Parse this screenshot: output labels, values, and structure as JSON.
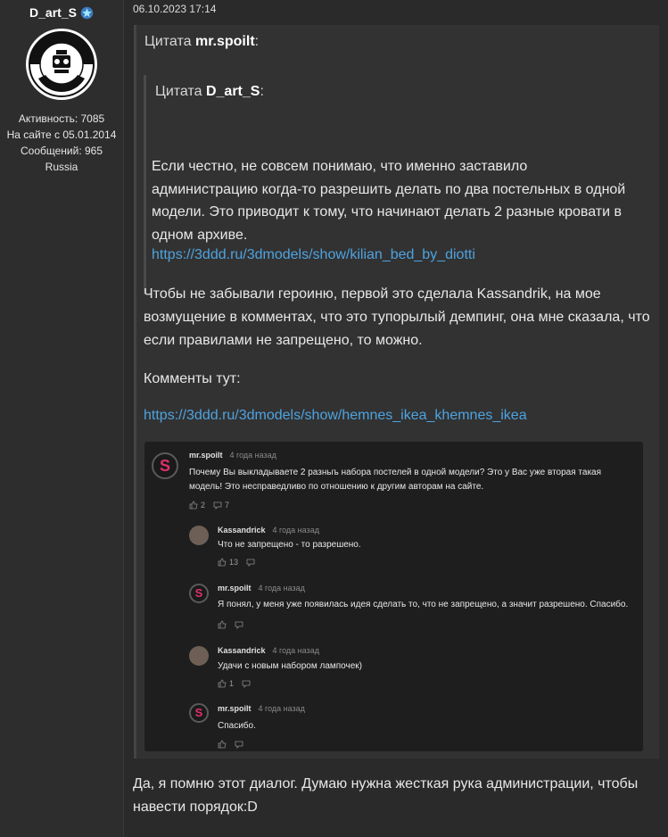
{
  "user": {
    "name": "D_art_S",
    "activity": "Активность: 7085",
    "since": "На сайте с 05.01.2014",
    "messages": "Сообщений: 965",
    "country": "Russia"
  },
  "post": {
    "date": "06.10.2023 17:14",
    "quote1": {
      "prefix": "Цитата ",
      "author": "mr.spoilt",
      "suffix": ":"
    },
    "quote2": {
      "prefix": "Цитата ",
      "author": "D_art_S",
      "suffix": ":",
      "text": "Если честно, не совсем понимаю, что именно заставило администрацию когда-то разрешить делать по два постельных в одной модели. Это приводит к тому, что начинают делать 2 разные кровати в одном архиве.",
      "link": "https://3ddd.ru/3dmodels/show/kilian_bed_by_diotti"
    },
    "quote1_text": "Чтобы не забывали героиню, первой это сделала Kassandrik, на мое возмущение в комментах, что это тупорылый демпинг, она мне сказала, что если правилами не запрещено, то можно.",
    "comments_label": "Комменты тут:",
    "comments_link": "https://3ddd.ru/3dmodels/show/hemnes_ikea_khemnes_ikea",
    "reply": "Да, я помню этот диалог. Думаю нужна жесткая рука администрации, чтобы навести порядок:D"
  },
  "comments": [
    {
      "author": "mr.spoilt",
      "time": "4 года назад",
      "text": "Почему Вы выкладываете 2 разныъ набора постелей в одной модели? Это у Вас уже вторая такая модель! Это несправедливо по отношению к другим авторам на сайте.",
      "likes": "2",
      "replies": "7",
      "avatar_letter": "S"
    },
    {
      "author": "Kassandrick",
      "time": "4 года назад",
      "text": "Что не запрещено - то разрешено.",
      "likes": "13",
      "replies": ""
    },
    {
      "author": "mr.spoilt",
      "time": "4 года назад",
      "text": "Я понял, у меня уже появилась идея сделать то, что не запрещено, а значит разрешено. Спасибо.",
      "likes": "",
      "replies": "",
      "avatar_letter": "S"
    },
    {
      "author": "Kassandrick",
      "time": "4 года назад",
      "text": "Удачи с новым набором лампочек)",
      "likes": "1",
      "replies": ""
    },
    {
      "author": "mr.spoilt",
      "time": "4 года назад",
      "text": "Спасибо.",
      "likes": "",
      "replies": "",
      "avatar_letter": "S"
    }
  ],
  "icons": {
    "star": "star-badge-icon",
    "like": "thumbs-up-icon",
    "reply": "speech-bubble-icon"
  },
  "colors": {
    "link": "#4ea3e0",
    "accent": "#e0306a"
  }
}
